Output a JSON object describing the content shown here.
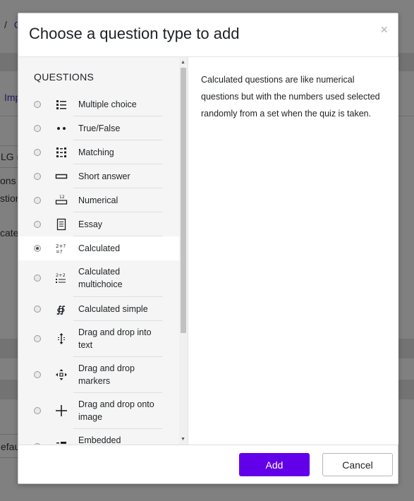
{
  "background": {
    "breadcrumb_sep": "/",
    "breadcrumb_link": "C",
    "link_fragment": "Imp",
    "select_fragment": "LG (S",
    "text_fragments": [
      "ons s",
      "stion",
      "cate"
    ],
    "input_fragment": "efau"
  },
  "dialog": {
    "title": "Choose a question type to add",
    "close_label": "×",
    "section_heading": "QUESTIONS",
    "options": [
      {
        "label": "Multiple choice",
        "icon": "multiple-choice-icon",
        "selected": false
      },
      {
        "label": "True/False",
        "icon": "true-false-icon",
        "selected": false
      },
      {
        "label": "Matching",
        "icon": "matching-icon",
        "selected": false
      },
      {
        "label": "Short answer",
        "icon": "short-answer-icon",
        "selected": false
      },
      {
        "label": "Numerical",
        "icon": "numerical-icon",
        "selected": false
      },
      {
        "label": "Essay",
        "icon": "essay-icon",
        "selected": false
      },
      {
        "label": "Calculated",
        "icon": "calculated-icon",
        "selected": true
      },
      {
        "label": "Calculated multichoice",
        "icon": "calculated-multichoice-icon",
        "selected": false
      },
      {
        "label": "Calculated simple",
        "icon": "calculated-simple-icon",
        "selected": false
      },
      {
        "label": "Drag and drop into text",
        "icon": "drag-drop-text-icon",
        "selected": false
      },
      {
        "label": "Drag and drop markers",
        "icon": "drag-drop-markers-icon",
        "selected": false
      },
      {
        "label": "Drag and drop onto image",
        "icon": "drag-drop-image-icon",
        "selected": false
      },
      {
        "label": "Embedded",
        "icon": "embedded-icon",
        "selected": false
      }
    ],
    "summary": "Calculated questions are like numerical questions but with the numbers used selected randomly from a set when the quiz is taken.",
    "add_label": "Add",
    "cancel_label": "Cancel",
    "accent_color": "#6200ea"
  }
}
